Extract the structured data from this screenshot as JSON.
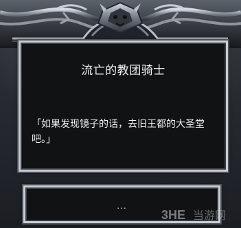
{
  "dialog": {
    "title": "流亡的教团骑士",
    "message": "「如果发现镜子的话，去旧王都的大圣堂吧。」"
  },
  "choice": {
    "label": "..."
  },
  "watermark": {
    "text": "3HE 当游网"
  }
}
